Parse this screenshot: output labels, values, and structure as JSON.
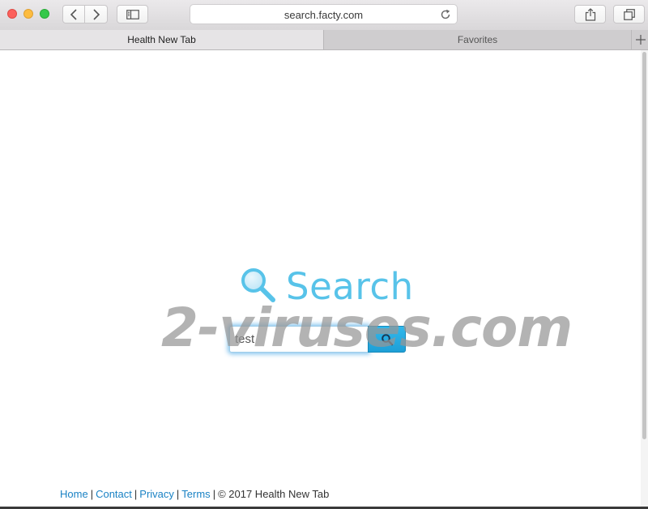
{
  "browser": {
    "url": "search.facty.com",
    "tabs": [
      {
        "label": "Health New Tab",
        "active": true
      },
      {
        "label": "Favorites",
        "active": false
      }
    ]
  },
  "page": {
    "logo_text": "Search",
    "search": {
      "value": "test"
    },
    "watermark": "2-viruses.com",
    "footer": {
      "links": [
        "Home",
        "Contact",
        "Privacy",
        "Terms"
      ],
      "copyright": "© 2017 Health New Tab"
    }
  },
  "colors": {
    "accent": "#58c3e9",
    "button": "#1e9fd6",
    "link": "#1a82c4"
  },
  "icons": [
    "back-icon",
    "forward-icon",
    "sidebar-icon",
    "reload-icon",
    "share-icon",
    "tabs-icon",
    "plus-icon",
    "magnifier-icon",
    "search-icon"
  ]
}
